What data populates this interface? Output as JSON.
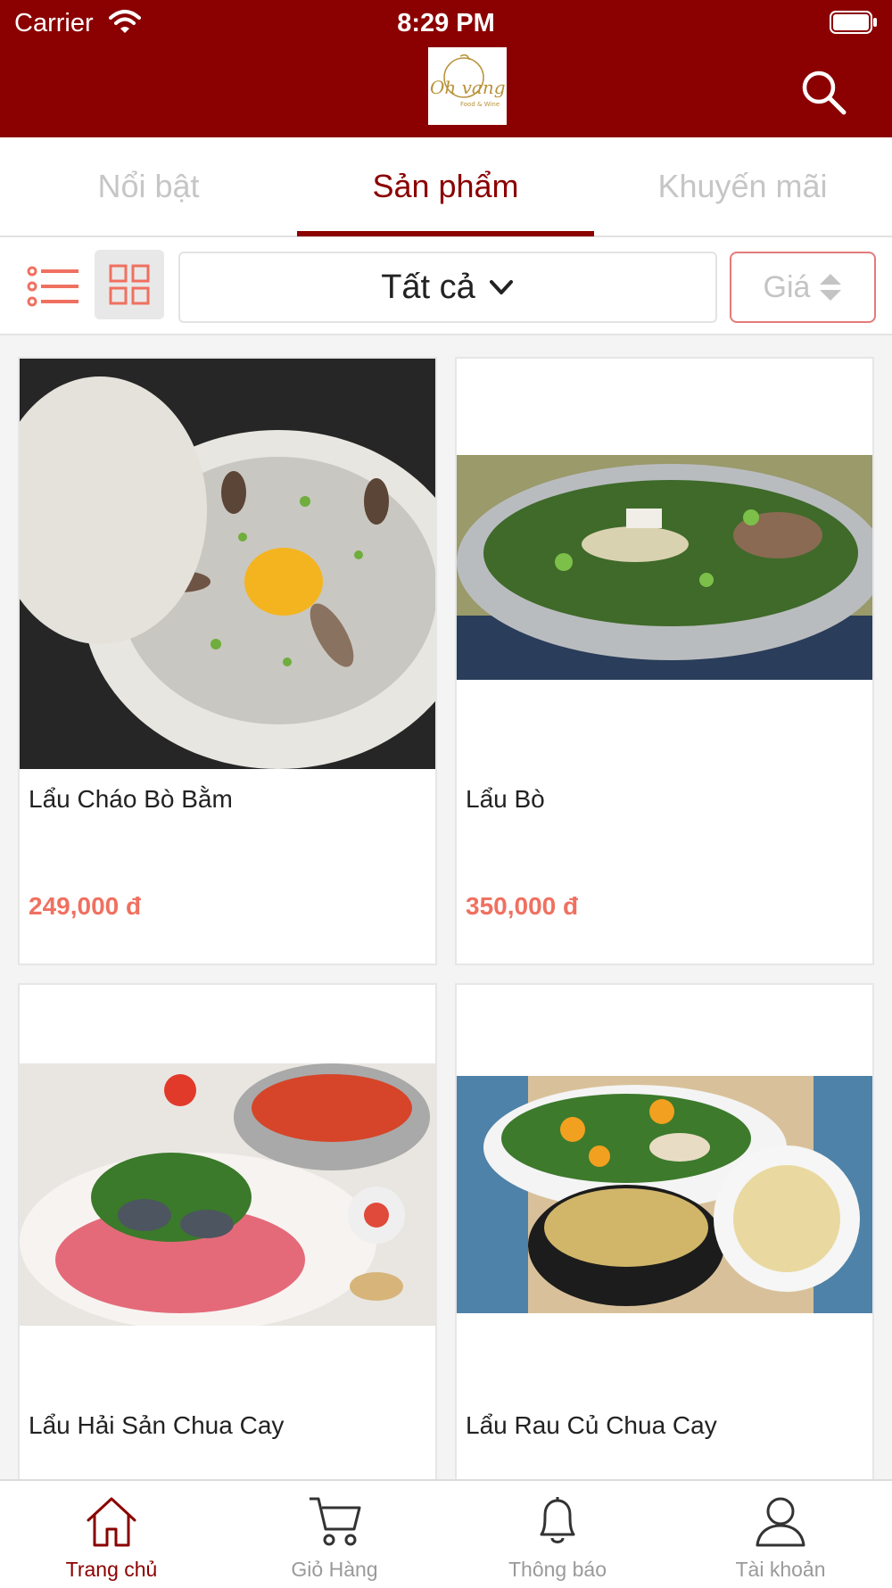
{
  "status_bar": {
    "carrier": "Carrier",
    "time": "8:29 PM"
  },
  "header": {
    "logo_text": "Oh vang",
    "logo_subtext": "Food & Wine",
    "search_icon": "search-icon"
  },
  "tabs": [
    {
      "label": "Nổi bật",
      "active": false
    },
    {
      "label": "Sản phẩm",
      "active": true
    },
    {
      "label": "Khuyến mãi",
      "active": false
    }
  ],
  "filter": {
    "list_view_icon": "list-view-icon",
    "grid_view_icon": "grid-view-icon",
    "category_selected": "Tất cả",
    "sort_label": "Giá"
  },
  "products": [
    {
      "name": "Lẩu Cháo Bò Bằm",
      "price": "249,000 đ",
      "image": "clay-pot-porridge"
    },
    {
      "name": "Lẩu Bò",
      "price": "350,000 đ",
      "image": "beef-hotpot"
    },
    {
      "name": "Lẩu Hải Sản Chua Cay",
      "price": "",
      "image": "seafood-hotpot"
    },
    {
      "name": "Lẩu Rau Củ Chua Cay",
      "price": "",
      "image": "vegetable-hotpot"
    }
  ],
  "bottom_nav": [
    {
      "label": "Trang chủ",
      "icon": "home-icon",
      "active": true
    },
    {
      "label": "Giỏ Hàng",
      "icon": "cart-icon",
      "active": false
    },
    {
      "label": "Thông báo",
      "icon": "bell-icon",
      "active": false
    },
    {
      "label": "Tài khoản",
      "icon": "user-icon",
      "active": false
    }
  ],
  "colors": {
    "brand": "#8b0000",
    "price": "#f07060",
    "accent_border": "#e47a7a"
  }
}
